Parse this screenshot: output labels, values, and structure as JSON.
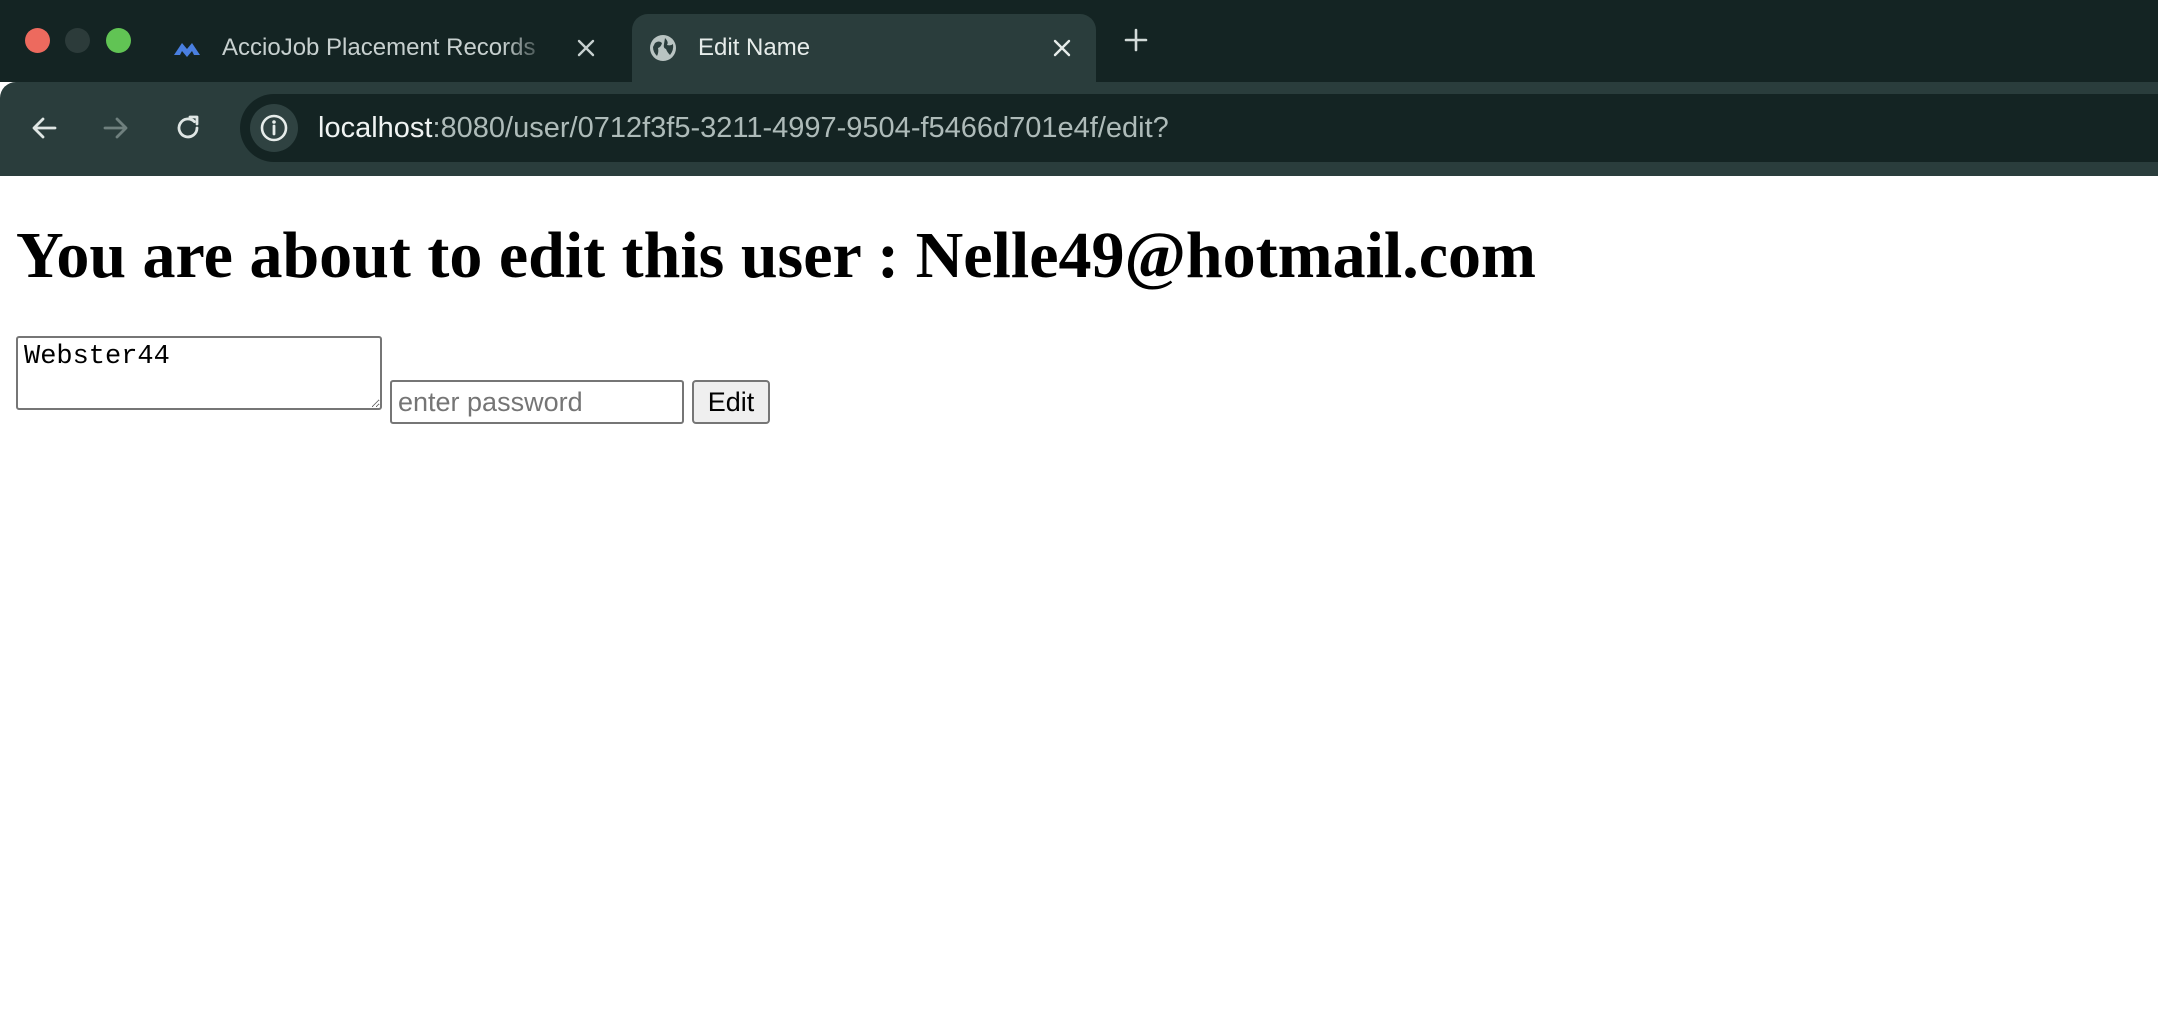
{
  "browser": {
    "tabs": [
      {
        "title": "AccioJob Placement Records",
        "favicon": "acciojob-logo-icon",
        "active": false
      },
      {
        "title": "Edit Name",
        "favicon": "globe-icon",
        "active": true
      }
    ],
    "url": {
      "host": "localhost",
      "path": ":8080/user/0712f3f5-3211-4997-9504-f5466d701e4f/edit?"
    },
    "colors": {
      "titlebar": "#142423",
      "toolbar": "#2a3d3c",
      "close_dot": "#ed6a5e",
      "zoom_dot": "#61c454",
      "acciojob_logo": "#4a7fe0"
    }
  },
  "page": {
    "heading": "You are about to edit this user : Nelle49@hotmail.com",
    "name_field": {
      "value": "Webster44"
    },
    "password_field": {
      "placeholder": "enter password",
      "value": ""
    },
    "edit_button_label": "Edit"
  }
}
